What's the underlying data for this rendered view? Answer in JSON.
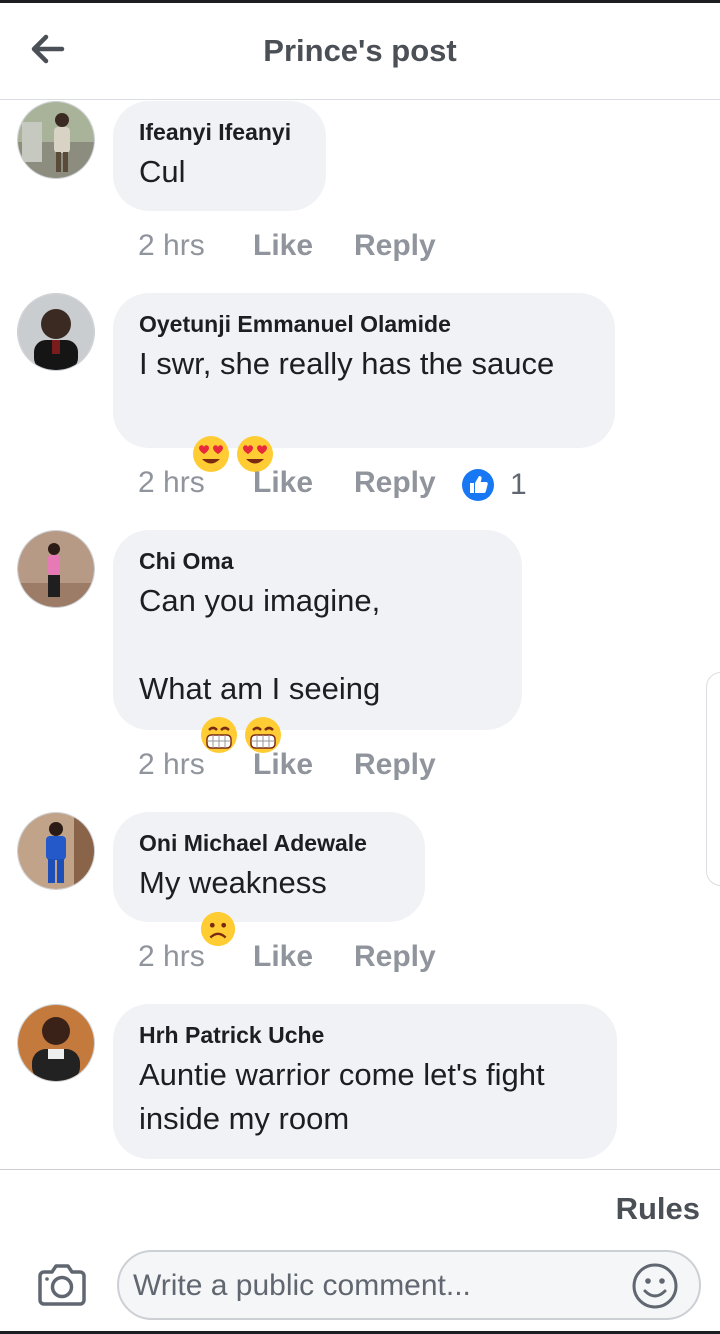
{
  "header": {
    "title": "Prince's post",
    "back_icon": "arrow-left-icon"
  },
  "comments": [
    {
      "author": "Ifeanyi Ifeanyi",
      "text": "Cul",
      "emojis": [],
      "time": "2 hrs",
      "like_label": "Like",
      "reply_label": "Reply",
      "reactions": null
    },
    {
      "author": "Oyetunji Emmanuel Olamide",
      "text": "I swr, she really has the sauce",
      "emojis": [
        "heart-eyes-emoji",
        "heart-eyes-emoji"
      ],
      "time": "2 hrs",
      "like_label": "Like",
      "reply_label": "Reply",
      "reactions": {
        "icon": "like-reaction-icon",
        "count": "1"
      }
    },
    {
      "author": "Chi Oma",
      "text": "Can you imagine,\n\nWhat am I seeing",
      "emojis": [
        "grinning-mask-emoji",
        "grinning-mask-emoji"
      ],
      "time": "2 hrs",
      "like_label": "Like",
      "reply_label": "Reply",
      "reactions": null
    },
    {
      "author": "Oni Michael Adewale",
      "text": "My weakness",
      "emojis": [
        "frowning-face-emoji"
      ],
      "time": "2 hrs",
      "like_label": "Like",
      "reply_label": "Reply",
      "reactions": null
    },
    {
      "author": "Hrh Patrick Uche",
      "text": "Auntie warrior come let's fight\ninside my room",
      "emojis": [],
      "time": "",
      "like_label": "",
      "reply_label": "",
      "reactions": null
    }
  ],
  "footer": {
    "rules_label": "Rules",
    "comment_placeholder": "Write a public comment...",
    "camera_icon": "camera-icon",
    "emoji_icon": "smiley-icon"
  },
  "colors": {
    "bubble": "#f0f2f5",
    "meta": "#90949c",
    "like_blue": "#1877f2"
  }
}
